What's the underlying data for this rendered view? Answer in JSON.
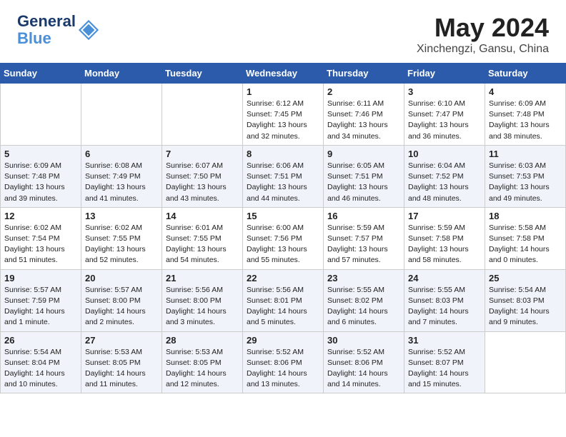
{
  "header": {
    "logo_line1": "General",
    "logo_line2": "Blue",
    "month_year": "May 2024",
    "location": "Xinchengzi, Gansu, China"
  },
  "weekdays": [
    "Sunday",
    "Monday",
    "Tuesday",
    "Wednesday",
    "Thursday",
    "Friday",
    "Saturday"
  ],
  "weeks": [
    [
      {
        "day": "",
        "info": ""
      },
      {
        "day": "",
        "info": ""
      },
      {
        "day": "",
        "info": ""
      },
      {
        "day": "1",
        "info": "Sunrise: 6:12 AM\nSunset: 7:45 PM\nDaylight: 13 hours\nand 32 minutes."
      },
      {
        "day": "2",
        "info": "Sunrise: 6:11 AM\nSunset: 7:46 PM\nDaylight: 13 hours\nand 34 minutes."
      },
      {
        "day": "3",
        "info": "Sunrise: 6:10 AM\nSunset: 7:47 PM\nDaylight: 13 hours\nand 36 minutes."
      },
      {
        "day": "4",
        "info": "Sunrise: 6:09 AM\nSunset: 7:48 PM\nDaylight: 13 hours\nand 38 minutes."
      }
    ],
    [
      {
        "day": "5",
        "info": "Sunrise: 6:09 AM\nSunset: 7:48 PM\nDaylight: 13 hours\nand 39 minutes."
      },
      {
        "day": "6",
        "info": "Sunrise: 6:08 AM\nSunset: 7:49 PM\nDaylight: 13 hours\nand 41 minutes."
      },
      {
        "day": "7",
        "info": "Sunrise: 6:07 AM\nSunset: 7:50 PM\nDaylight: 13 hours\nand 43 minutes."
      },
      {
        "day": "8",
        "info": "Sunrise: 6:06 AM\nSunset: 7:51 PM\nDaylight: 13 hours\nand 44 minutes."
      },
      {
        "day": "9",
        "info": "Sunrise: 6:05 AM\nSunset: 7:51 PM\nDaylight: 13 hours\nand 46 minutes."
      },
      {
        "day": "10",
        "info": "Sunrise: 6:04 AM\nSunset: 7:52 PM\nDaylight: 13 hours\nand 48 minutes."
      },
      {
        "day": "11",
        "info": "Sunrise: 6:03 AM\nSunset: 7:53 PM\nDaylight: 13 hours\nand 49 minutes."
      }
    ],
    [
      {
        "day": "12",
        "info": "Sunrise: 6:02 AM\nSunset: 7:54 PM\nDaylight: 13 hours\nand 51 minutes."
      },
      {
        "day": "13",
        "info": "Sunrise: 6:02 AM\nSunset: 7:55 PM\nDaylight: 13 hours\nand 52 minutes."
      },
      {
        "day": "14",
        "info": "Sunrise: 6:01 AM\nSunset: 7:55 PM\nDaylight: 13 hours\nand 54 minutes."
      },
      {
        "day": "15",
        "info": "Sunrise: 6:00 AM\nSunset: 7:56 PM\nDaylight: 13 hours\nand 55 minutes."
      },
      {
        "day": "16",
        "info": "Sunrise: 5:59 AM\nSunset: 7:57 PM\nDaylight: 13 hours\nand 57 minutes."
      },
      {
        "day": "17",
        "info": "Sunrise: 5:59 AM\nSunset: 7:58 PM\nDaylight: 13 hours\nand 58 minutes."
      },
      {
        "day": "18",
        "info": "Sunrise: 5:58 AM\nSunset: 7:58 PM\nDaylight: 14 hours\nand 0 minutes."
      }
    ],
    [
      {
        "day": "19",
        "info": "Sunrise: 5:57 AM\nSunset: 7:59 PM\nDaylight: 14 hours\nand 1 minute."
      },
      {
        "day": "20",
        "info": "Sunrise: 5:57 AM\nSunset: 8:00 PM\nDaylight: 14 hours\nand 2 minutes."
      },
      {
        "day": "21",
        "info": "Sunrise: 5:56 AM\nSunset: 8:00 PM\nDaylight: 14 hours\nand 3 minutes."
      },
      {
        "day": "22",
        "info": "Sunrise: 5:56 AM\nSunset: 8:01 PM\nDaylight: 14 hours\nand 5 minutes."
      },
      {
        "day": "23",
        "info": "Sunrise: 5:55 AM\nSunset: 8:02 PM\nDaylight: 14 hours\nand 6 minutes."
      },
      {
        "day": "24",
        "info": "Sunrise: 5:55 AM\nSunset: 8:03 PM\nDaylight: 14 hours\nand 7 minutes."
      },
      {
        "day": "25",
        "info": "Sunrise: 5:54 AM\nSunset: 8:03 PM\nDaylight: 14 hours\nand 9 minutes."
      }
    ],
    [
      {
        "day": "26",
        "info": "Sunrise: 5:54 AM\nSunset: 8:04 PM\nDaylight: 14 hours\nand 10 minutes."
      },
      {
        "day": "27",
        "info": "Sunrise: 5:53 AM\nSunset: 8:05 PM\nDaylight: 14 hours\nand 11 minutes."
      },
      {
        "day": "28",
        "info": "Sunrise: 5:53 AM\nSunset: 8:05 PM\nDaylight: 14 hours\nand 12 minutes."
      },
      {
        "day": "29",
        "info": "Sunrise: 5:52 AM\nSunset: 8:06 PM\nDaylight: 14 hours\nand 13 minutes."
      },
      {
        "day": "30",
        "info": "Sunrise: 5:52 AM\nSunset: 8:06 PM\nDaylight: 14 hours\nand 14 minutes."
      },
      {
        "day": "31",
        "info": "Sunrise: 5:52 AM\nSunset: 8:07 PM\nDaylight: 14 hours\nand 15 minutes."
      },
      {
        "day": "",
        "info": ""
      }
    ]
  ]
}
